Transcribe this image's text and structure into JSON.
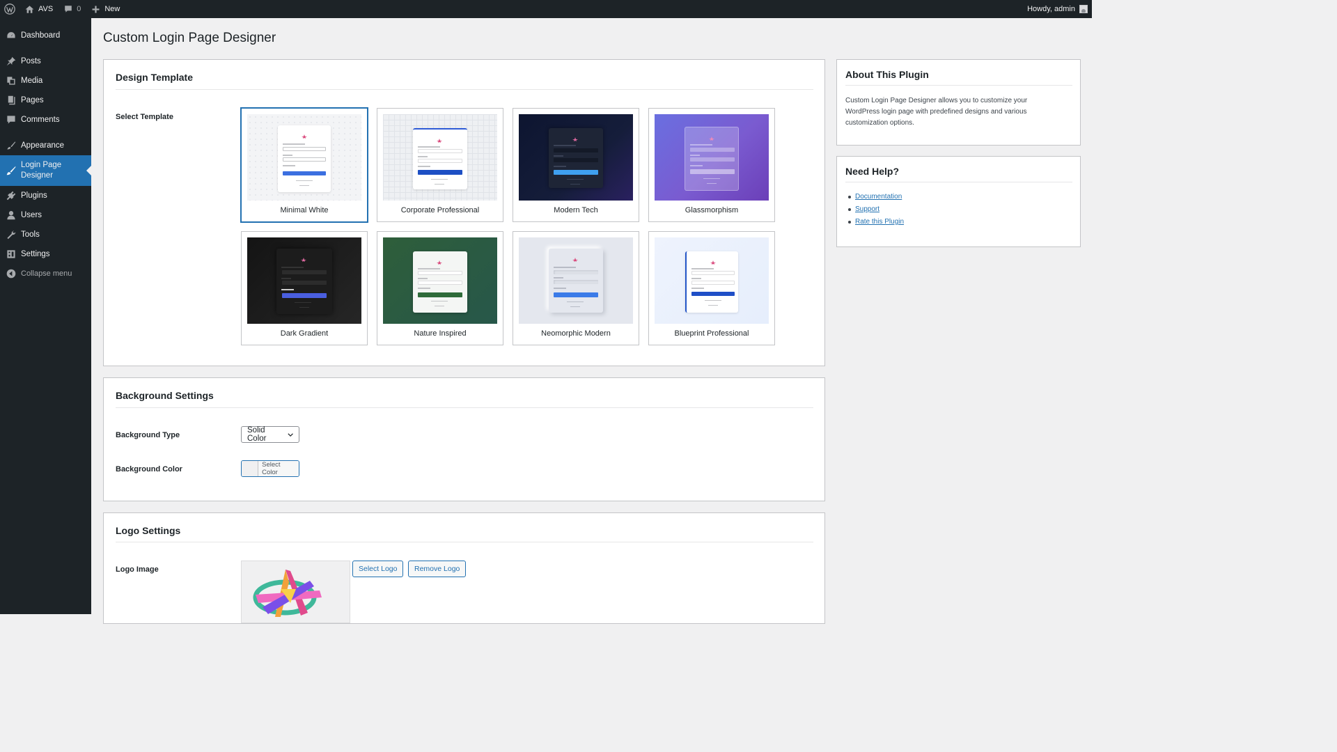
{
  "adminbar": {
    "site_name": "AVS",
    "comments_count": "0",
    "new_label": "New",
    "greeting": "Howdy, admin"
  },
  "sidebar": {
    "items": [
      {
        "label": "Dashboard",
        "icon": "dashboard-icon"
      },
      {
        "label": "Posts",
        "icon": "pin-icon"
      },
      {
        "label": "Media",
        "icon": "media-icon"
      },
      {
        "label": "Pages",
        "icon": "pages-icon"
      },
      {
        "label": "Comments",
        "icon": "comment-icon"
      },
      {
        "label": "Appearance",
        "icon": "brush-icon"
      },
      {
        "label": "Login Page Designer",
        "icon": "paintbrush-icon",
        "active": true
      },
      {
        "label": "Plugins",
        "icon": "plugin-icon"
      },
      {
        "label": "Users",
        "icon": "user-icon"
      },
      {
        "label": "Tools",
        "icon": "wrench-icon"
      },
      {
        "label": "Settings",
        "icon": "settings-icon"
      }
    ],
    "collapse_label": "Collapse menu"
  },
  "page": {
    "title": "Custom Login Page Designer"
  },
  "design_template": {
    "heading": "Design Template",
    "select_label": "Select Template",
    "templates": [
      {
        "name": "Minimal White",
        "selected": true
      },
      {
        "name": "Corporate Professional"
      },
      {
        "name": "Modern Tech"
      },
      {
        "name": "Glassmorphism"
      },
      {
        "name": "Dark Gradient"
      },
      {
        "name": "Nature Inspired"
      },
      {
        "name": "Neomorphic Modern"
      },
      {
        "name": "Blueprint Professional"
      }
    ]
  },
  "background": {
    "heading": "Background Settings",
    "type_label": "Background Type",
    "type_value": "Solid Color",
    "color_label": "Background Color",
    "color_button": "Select Color"
  },
  "logo": {
    "heading": "Logo Settings",
    "image_label": "Logo Image",
    "select_button": "Select Logo",
    "remove_button": "Remove Logo"
  },
  "about": {
    "heading": "About This Plugin",
    "text": "Custom Login Page Designer allows you to customize your WordPress login page with predefined designs and various customization options."
  },
  "help": {
    "heading": "Need Help?",
    "links": [
      "Documentation",
      "Support",
      "Rate this Plugin"
    ]
  },
  "colors": {
    "admin_dark": "#1d2327",
    "accent": "#2271b1",
    "page_bg": "#f0f0f1"
  }
}
